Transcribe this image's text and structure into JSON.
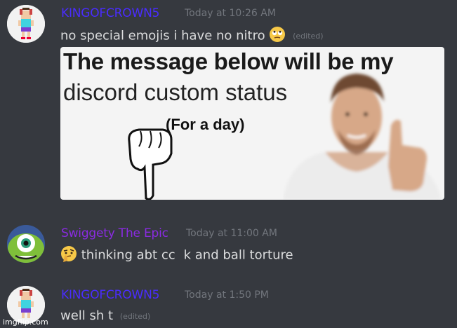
{
  "messages": [
    {
      "username": "KINGOFCROWN5",
      "username_color": "#4a2cff",
      "timestamp": "Today at 10:26 AM",
      "text": "no special emojis i have no nitro",
      "edited": "(edited)",
      "emoji": "rolling-eyes-emoji"
    },
    {
      "username": "Swiggety The Epic",
      "username_color": "#8a2be2",
      "timestamp": "Today at 11:00 AM",
      "text_before": "thinking abt cc",
      "text_after": "k and ball torture",
      "emoji": "thinking-face-emoji"
    },
    {
      "username": "KINGOFCROWN5",
      "username_color": "#4a2cff",
      "timestamp": "Today at 1:50 PM",
      "text": "well sh t",
      "edited": "(edited)"
    }
  ],
  "meme": {
    "line1": "The message below will be my",
    "line2": "discord custom status",
    "line3": "(For a day)"
  },
  "watermark": "imgflip.com"
}
